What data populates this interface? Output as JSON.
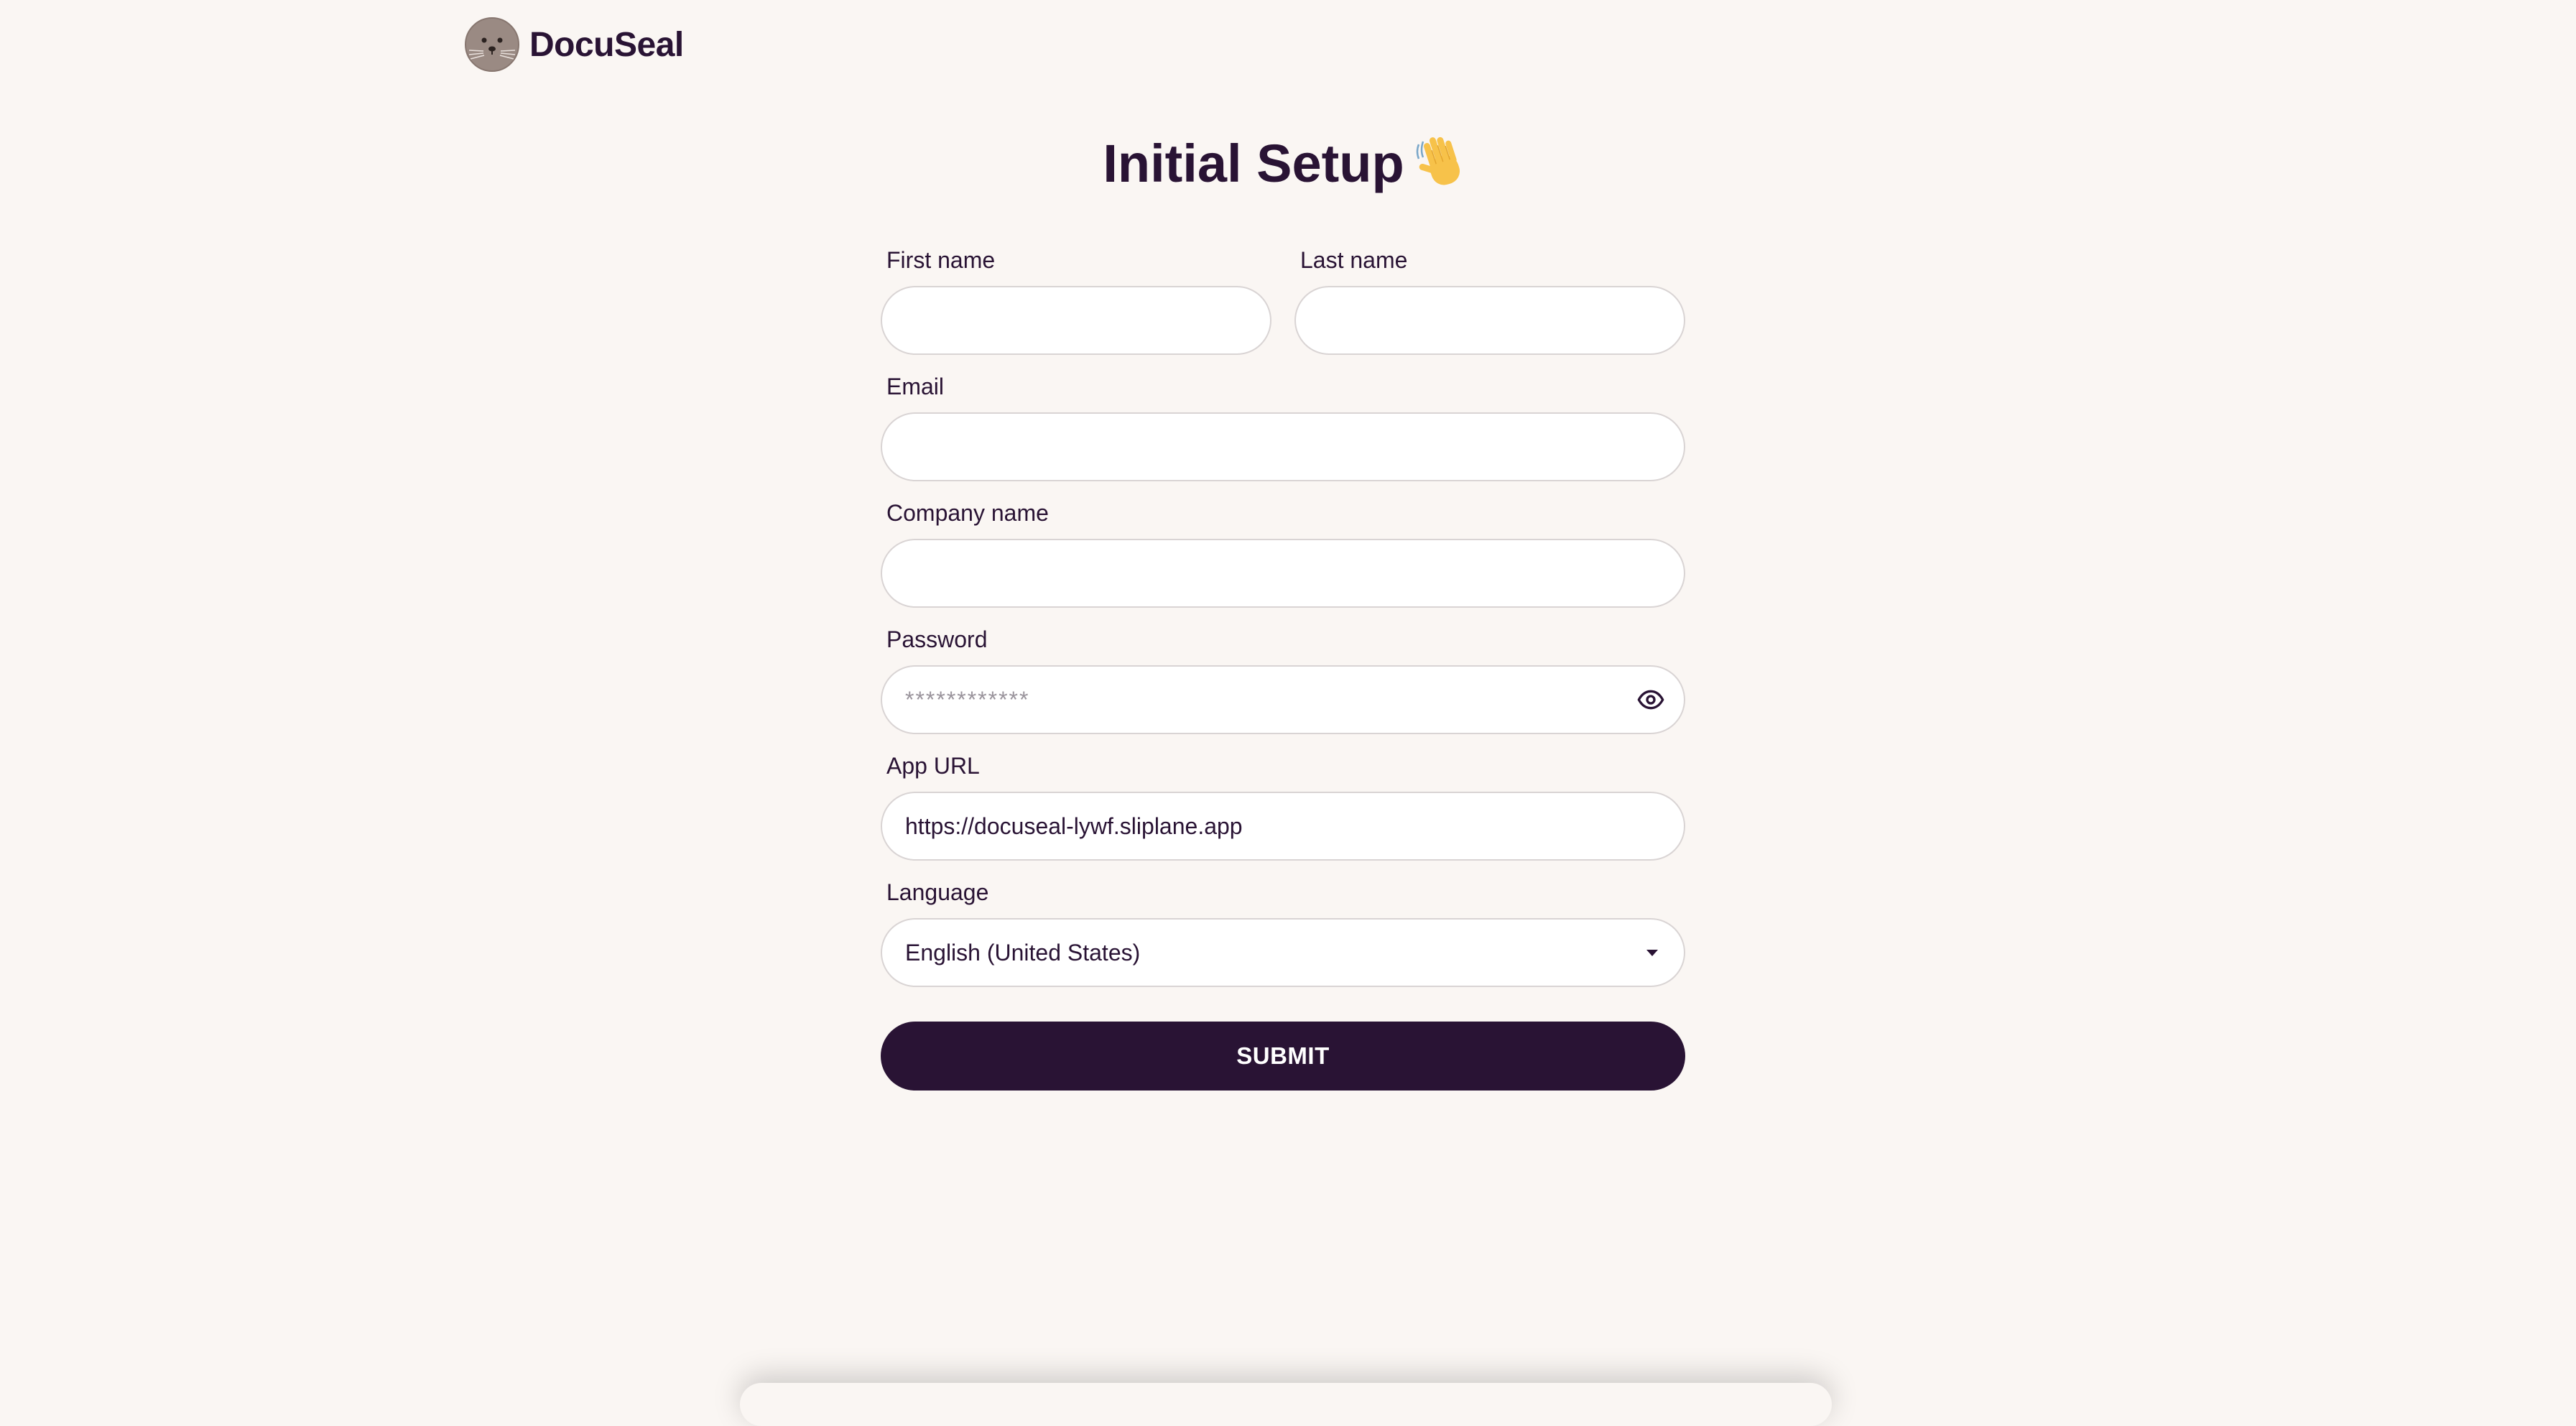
{
  "header": {
    "brand": "DocuSeal",
    "logo_icon": "seal-logo-icon"
  },
  "title": {
    "text": "Initial Setup",
    "emoji_icon": "waving-hand-icon"
  },
  "form": {
    "first_name": {
      "label": "First name",
      "value": "",
      "placeholder": ""
    },
    "last_name": {
      "label": "Last name",
      "value": "",
      "placeholder": ""
    },
    "email": {
      "label": "Email",
      "value": "",
      "placeholder": ""
    },
    "company_name": {
      "label": "Company name",
      "value": "",
      "placeholder": ""
    },
    "password": {
      "label": "Password",
      "value": "",
      "placeholder": "************",
      "toggle_icon": "eye-icon"
    },
    "app_url": {
      "label": "App URL",
      "value": "https://docuseal-lywf.sliplane.app"
    },
    "language": {
      "label": "Language",
      "selected": "English (United States)",
      "dropdown_icon": "caret-down-icon"
    },
    "submit_label": "SUBMIT"
  },
  "colors": {
    "background": "#faf6f3",
    "primary": "#291334",
    "input_border": "#d9d4d4"
  }
}
